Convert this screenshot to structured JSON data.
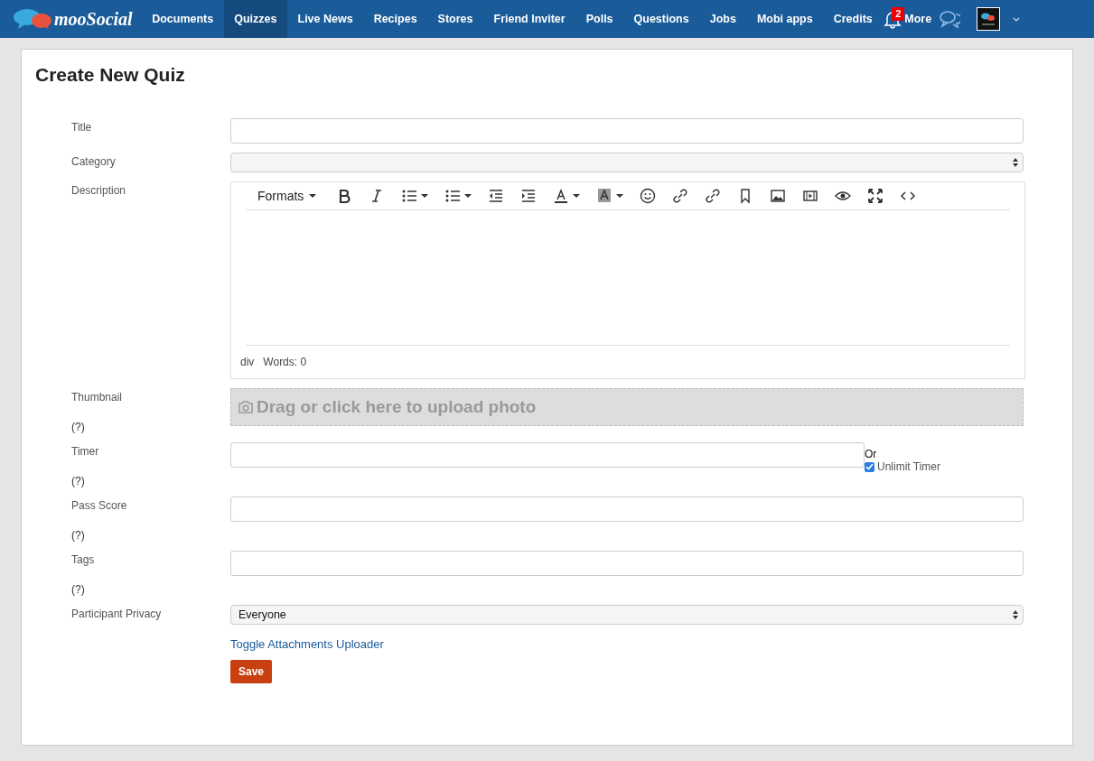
{
  "nav": {
    "logo": "mooSocial",
    "items": [
      {
        "label": "Documents",
        "selected": false
      },
      {
        "label": "Quizzes",
        "selected": true
      },
      {
        "label": "Live News",
        "selected": false
      },
      {
        "label": "Recipes",
        "selected": false
      },
      {
        "label": "Stores",
        "selected": false
      },
      {
        "label": "Friend Inviter",
        "selected": false
      },
      {
        "label": "Polls",
        "selected": false
      },
      {
        "label": "Questions",
        "selected": false
      },
      {
        "label": "Jobs",
        "selected": false
      },
      {
        "label": "Mobi apps",
        "selected": false
      },
      {
        "label": "Credits",
        "selected": false
      }
    ],
    "notification_count": "2",
    "more": "More"
  },
  "page": {
    "title": "Create New Quiz"
  },
  "form": {
    "title": {
      "label": "Title"
    },
    "category": {
      "label": "Category"
    },
    "description": {
      "label": "Description",
      "formats": "Formats",
      "path": "div",
      "word_count": "Words: 0"
    },
    "thumbnail": {
      "label": "Thumbnail",
      "help": "(?)",
      "upload": "Drag or click here to upload photo"
    },
    "timer": {
      "label": "Timer",
      "help": "(?)",
      "or": "Or",
      "unlimited": {
        "label": "Unlimit Timer",
        "checked": true
      }
    },
    "pass_score": {
      "label": "Pass Score",
      "help": "(?)"
    },
    "tags": {
      "label": "Tags",
      "help": "(?)"
    },
    "privacy": {
      "label": "Participant Privacy",
      "value": "Everyone"
    },
    "attachments_link": "Toggle Attachments Uploader",
    "save": "Save"
  }
}
